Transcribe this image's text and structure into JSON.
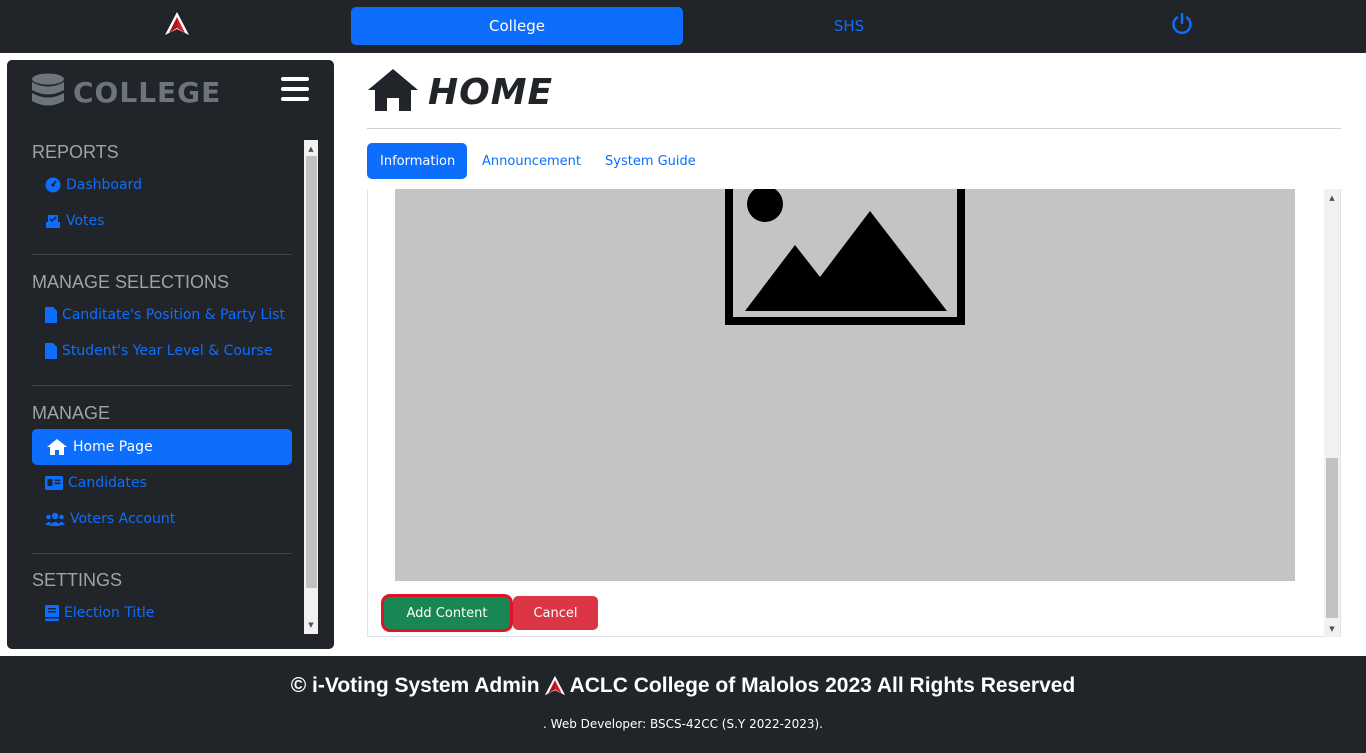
{
  "topbar": {
    "college_label": "College",
    "shs_label": "SHS"
  },
  "sidebar": {
    "brand": "COLLEGE",
    "sections": {
      "reports": "REPORTS",
      "manage_selections": "MANAGE SELECTIONS",
      "manage": "MANAGE",
      "settings": "SETTINGS"
    },
    "items": {
      "dashboard": "Dashboard",
      "votes": "Votes",
      "position_party": "Canditate's Position & Party List",
      "year_course": "Student's Year Level & Course",
      "home_page": "Home Page",
      "candidates": "Candidates",
      "voters_account": "Voters Account",
      "election_title": "Election Title"
    }
  },
  "main": {
    "title": "HOME",
    "tabs": [
      "Information",
      "Announcement",
      "System Guide"
    ],
    "add_content_label": "Add Content",
    "cancel_label": "Cancel"
  },
  "footer": {
    "prefix": "© i-Voting System Admin",
    "suffix": "ACLC College of Malolos 2023 All Rights Reserved",
    "sub": ". Web Developer: BSCS-42CC (S.Y 2022-2023)."
  },
  "colors": {
    "primary": "#0d6efd",
    "dark": "#212529",
    "success": "#198754",
    "danger": "#dc3545",
    "highlight": "#e0132b"
  }
}
